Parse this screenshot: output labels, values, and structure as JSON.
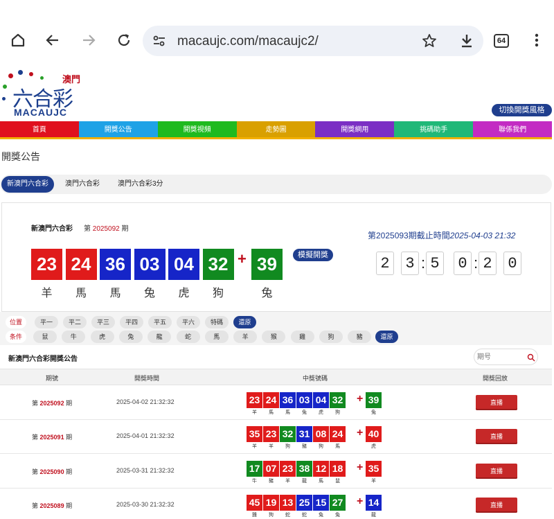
{
  "browser": {
    "url": "macaujc.com/macaujc2/",
    "tab_count": "64"
  },
  "logo": {
    "macau": "澳門",
    "main": "六合彩",
    "en": "MACAUJC"
  },
  "switch_style": "切換開獎風格",
  "nav": [
    {
      "label": "首頁",
      "color": "#e0101e"
    },
    {
      "label": "開獎公告",
      "color": "#1fa2e6"
    },
    {
      "label": "開獎視頻",
      "color": "#1fba1f"
    },
    {
      "label": "走勢圖",
      "color": "#d9a000"
    },
    {
      "label": "開獎網用",
      "color": "#7b2fc4"
    },
    {
      "label": "挑碼助手",
      "color": "#20b878"
    },
    {
      "label": "聯係我們",
      "color": "#c32bc3"
    }
  ],
  "page_title": "開獎公告",
  "tabs": [
    {
      "label": "新澳門六合彩",
      "active": true
    },
    {
      "label": "澳門六合彩",
      "active": false
    },
    {
      "label": "澳門六合彩3分",
      "active": false
    }
  ],
  "current": {
    "lottery_name": "新澳門六合彩",
    "issue_prefix": "第",
    "issue_number": "2025092",
    "issue_suffix": "期",
    "balls": [
      {
        "num": "23",
        "color": "red",
        "zodiac": "羊"
      },
      {
        "num": "24",
        "color": "red",
        "zodiac": "馬"
      },
      {
        "num": "36",
        "color": "blue",
        "zodiac": "馬"
      },
      {
        "num": "03",
        "color": "blue",
        "zodiac": "兔"
      },
      {
        "num": "04",
        "color": "blue",
        "zodiac": "虎"
      },
      {
        "num": "32",
        "color": "green",
        "zodiac": "狗"
      }
    ],
    "special": {
      "num": "39",
      "color": "green",
      "zodiac": "兔"
    },
    "simulate_label": "模擬開獎",
    "next_prefix": "第2025093期截止時間",
    "next_time": "2025-04-03 21:32",
    "countdown": [
      "2",
      "3",
      "5",
      "0",
      "2",
      "0"
    ]
  },
  "filters": {
    "position_label": "位置",
    "positions": [
      "平一",
      "平二",
      "平三",
      "平四",
      "平五",
      "平六",
      "特碼"
    ],
    "condition_label": "条件",
    "zodiacs": [
      "鼠",
      "牛",
      "虎",
      "兔",
      "龍",
      "蛇",
      "馬",
      "羊",
      "猴",
      "雞",
      "狗",
      "豬"
    ],
    "reset_label": "還原"
  },
  "table": {
    "title": "新澳門六合彩開獎公告",
    "search_placeholder": "期号",
    "headers": [
      "期號",
      "開獎時間",
      "中獎號碼",
      "開獎回放"
    ],
    "live_label": "直播",
    "rows": [
      {
        "prefix": "第",
        "issue": "2025092",
        "suffix": "期",
        "time": "2025-04-02 21:32:32",
        "balls": [
          {
            "num": "23",
            "color": "red",
            "zodiac": "羊"
          },
          {
            "num": "24",
            "color": "red",
            "zodiac": "馬"
          },
          {
            "num": "36",
            "color": "blue",
            "zodiac": "馬"
          },
          {
            "num": "03",
            "color": "blue",
            "zodiac": "兔"
          },
          {
            "num": "04",
            "color": "blue",
            "zodiac": "虎"
          },
          {
            "num": "32",
            "color": "green",
            "zodiac": "狗"
          }
        ],
        "special": {
          "num": "39",
          "color": "green",
          "zodiac": "兔"
        }
      },
      {
        "prefix": "第",
        "issue": "2025091",
        "suffix": "期",
        "time": "2025-04-01 21:32:32",
        "balls": [
          {
            "num": "35",
            "color": "red",
            "zodiac": "羊"
          },
          {
            "num": "23",
            "color": "red",
            "zodiac": "羊"
          },
          {
            "num": "32",
            "color": "green",
            "zodiac": "狗"
          },
          {
            "num": "31",
            "color": "blue",
            "zodiac": "豬"
          },
          {
            "num": "08",
            "color": "red",
            "zodiac": "狗"
          },
          {
            "num": "24",
            "color": "red",
            "zodiac": "馬"
          }
        ],
        "special": {
          "num": "40",
          "color": "red",
          "zodiac": "虎"
        }
      },
      {
        "prefix": "第",
        "issue": "2025090",
        "suffix": "期",
        "time": "2025-03-31 21:32:32",
        "balls": [
          {
            "num": "17",
            "color": "green",
            "zodiac": "牛"
          },
          {
            "num": "07",
            "color": "red",
            "zodiac": "豬"
          },
          {
            "num": "23",
            "color": "red",
            "zodiac": "羊"
          },
          {
            "num": "38",
            "color": "green",
            "zodiac": "龍"
          },
          {
            "num": "12",
            "color": "red",
            "zodiac": "馬"
          },
          {
            "num": "18",
            "color": "red",
            "zodiac": "鼠"
          }
        ],
        "special": {
          "num": "35",
          "color": "red",
          "zodiac": "羊"
        }
      },
      {
        "prefix": "第",
        "issue": "2025089",
        "suffix": "期",
        "time": "2025-03-30 21:32:32",
        "balls": [
          {
            "num": "45",
            "color": "red",
            "zodiac": "雞"
          },
          {
            "num": "19",
            "color": "red",
            "zodiac": "狗"
          },
          {
            "num": "13",
            "color": "red",
            "zodiac": "蛇"
          },
          {
            "num": "25",
            "color": "blue",
            "zodiac": "蛇"
          },
          {
            "num": "15",
            "color": "blue",
            "zodiac": "兔"
          },
          {
            "num": "27",
            "color": "green",
            "zodiac": "兔"
          }
        ],
        "special": {
          "num": "14",
          "color": "blue",
          "zodiac": "龍"
        }
      }
    ]
  }
}
